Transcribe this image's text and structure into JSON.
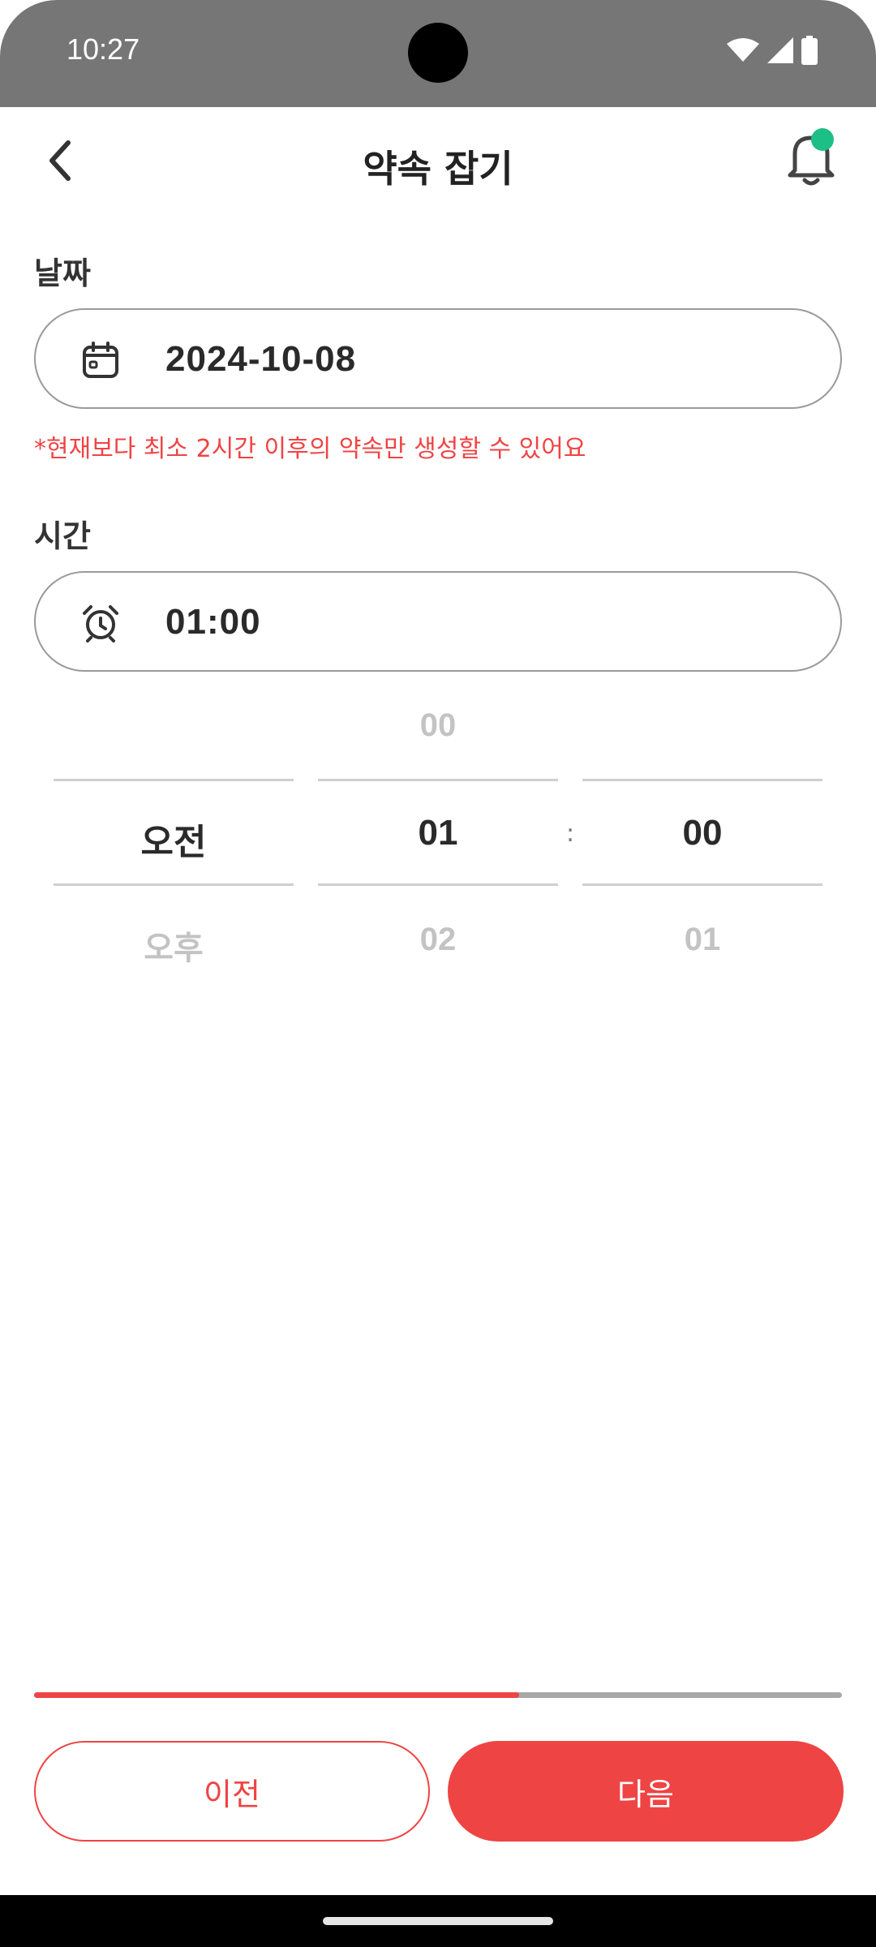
{
  "status_bar": {
    "time": "10:27"
  },
  "header": {
    "title": "약속 잡기"
  },
  "date_section": {
    "label": "날짜",
    "value": "2024-10-08"
  },
  "warning_text": "*현재보다 최소 2시간 이후의 약속만 생성할 수 있어요",
  "time_section": {
    "label": "시간",
    "value": "01:00"
  },
  "picker": {
    "ampm": {
      "selected": "오전",
      "below": "오후"
    },
    "hour": {
      "above": "00",
      "selected": "01",
      "below": "02"
    },
    "minute": {
      "selected": "00",
      "below": "01"
    },
    "separator": ":"
  },
  "progress": {
    "fraction": 0.6
  },
  "buttons": {
    "prev_label": "이전",
    "next_label": "다음"
  },
  "colors": {
    "accent": "#ef4444",
    "notification_dot": "#1dbf87"
  }
}
